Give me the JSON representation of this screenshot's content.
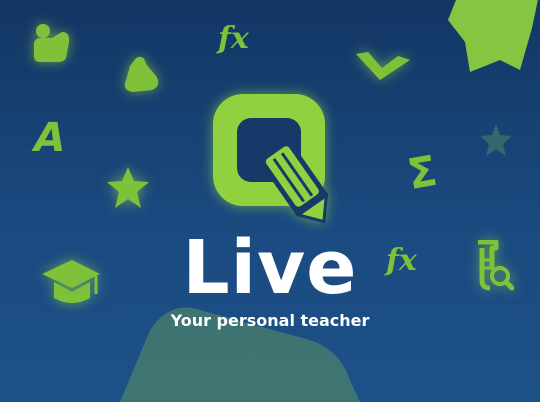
{
  "splash": {
    "title": "Live",
    "tagline": "Your personal teacher",
    "icons": {
      "fx_top": "fx",
      "fx_right": "fx",
      "sigma": "Σ",
      "letter_a": "A"
    }
  },
  "colors": {
    "background_top": "#133664",
    "background_bottom": "#1c5188",
    "accent_green": "#8fd13f",
    "text": "#ffffff"
  }
}
